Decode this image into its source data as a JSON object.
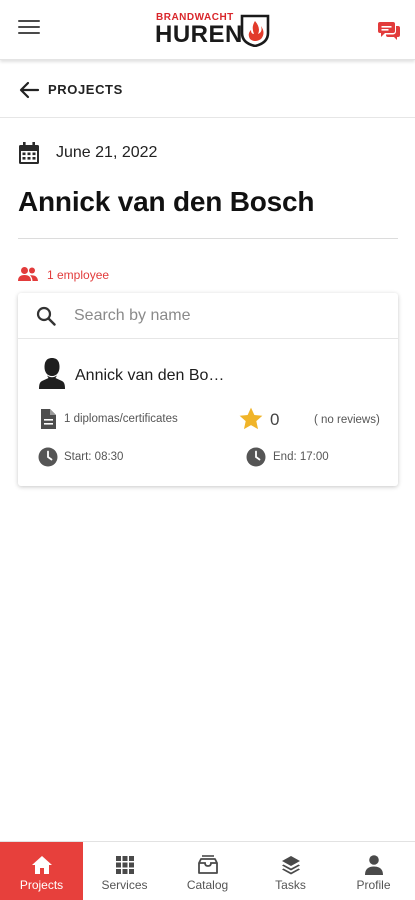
{
  "header": {
    "logo_top": "BRANDWACHT",
    "logo_main": "HUREN"
  },
  "back": {
    "label": "PROJECTS"
  },
  "project": {
    "date": "June 21, 2022",
    "title": "Annick van den Bosch",
    "employee_count": "1 employee"
  },
  "search": {
    "placeholder": "Search by name",
    "value": ""
  },
  "employees": [
    {
      "name": "Annick van den Bosch",
      "documents": "1 diplomas/certificates",
      "rating": "0",
      "reviews": "( no reviews)",
      "start": "Start: 08:30",
      "end": "End: 17:00"
    }
  ],
  "nav": {
    "items": [
      {
        "label": "Projects",
        "icon": "home-icon",
        "active": true
      },
      {
        "label": "Services",
        "icon": "grid-icon",
        "active": false
      },
      {
        "label": "Catalog",
        "icon": "catalog-icon",
        "active": false
      },
      {
        "label": "Tasks",
        "icon": "layers-icon",
        "active": false
      },
      {
        "label": "Profile",
        "icon": "person-icon",
        "active": false
      }
    ]
  },
  "colors": {
    "accent": "#e7403c",
    "star": "#f0b429",
    "icon_dark": "#4a4a4a"
  }
}
